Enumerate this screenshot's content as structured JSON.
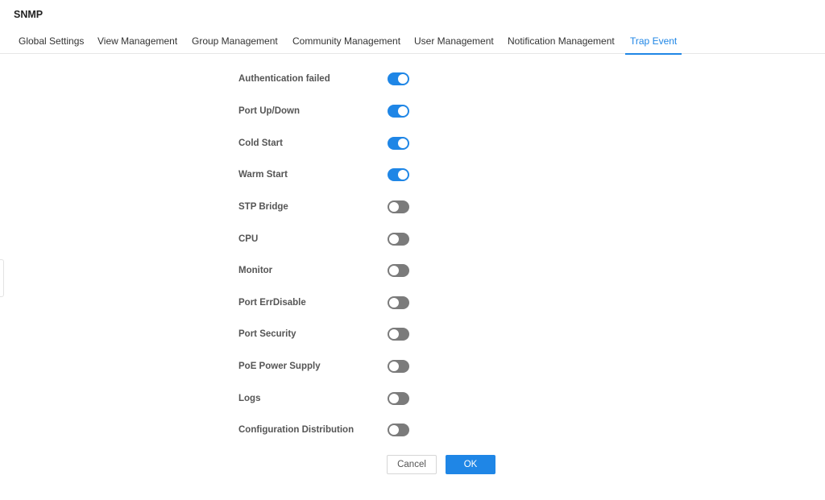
{
  "page": {
    "title": "SNMP"
  },
  "tabs": [
    {
      "label": "Global Settings",
      "active": false
    },
    {
      "label": "View Management",
      "active": false
    },
    {
      "label": "Group Management",
      "active": false
    },
    {
      "label": "Community Management",
      "active": false
    },
    {
      "label": "User Management",
      "active": false
    },
    {
      "label": "Notification Management",
      "active": false
    },
    {
      "label": "Trap Event",
      "active": true
    }
  ],
  "trap_events": [
    {
      "label": "Authentication failed",
      "enabled": true
    },
    {
      "label": "Port Up/Down",
      "enabled": true
    },
    {
      "label": "Cold Start",
      "enabled": true
    },
    {
      "label": "Warm Start",
      "enabled": true
    },
    {
      "label": "STP Bridge",
      "enabled": false
    },
    {
      "label": "CPU",
      "enabled": false
    },
    {
      "label": "Monitor",
      "enabled": false
    },
    {
      "label": "Port ErrDisable",
      "enabled": false
    },
    {
      "label": "Port Security",
      "enabled": false
    },
    {
      "label": "PoE Power Supply",
      "enabled": false
    },
    {
      "label": "Logs",
      "enabled": false
    },
    {
      "label": "Configuration Distribution",
      "enabled": false
    }
  ],
  "actions": {
    "cancel_label": "Cancel",
    "ok_label": "OK"
  },
  "colors": {
    "accent": "#1f86e6",
    "switch_off": "#7b7b7b"
  }
}
